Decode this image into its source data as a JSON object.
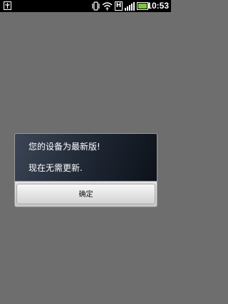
{
  "status_bar": {
    "time": "10:53",
    "h_indicator": "H",
    "icons": [
      "usb-icon",
      "vibrate-icon",
      "wifi-icon",
      "h-network-icon",
      "signal-icon",
      "battery-icon"
    ],
    "battery_color": "#7ec242"
  },
  "dialog": {
    "message_line_1": "您的设备为最新版!",
    "message_line_2": "现在无需更新.",
    "confirm_label": "确定"
  },
  "colors": {
    "background": "#6e6e6e",
    "dialog_body": "#1d2532",
    "button": "#e2e2e2"
  }
}
